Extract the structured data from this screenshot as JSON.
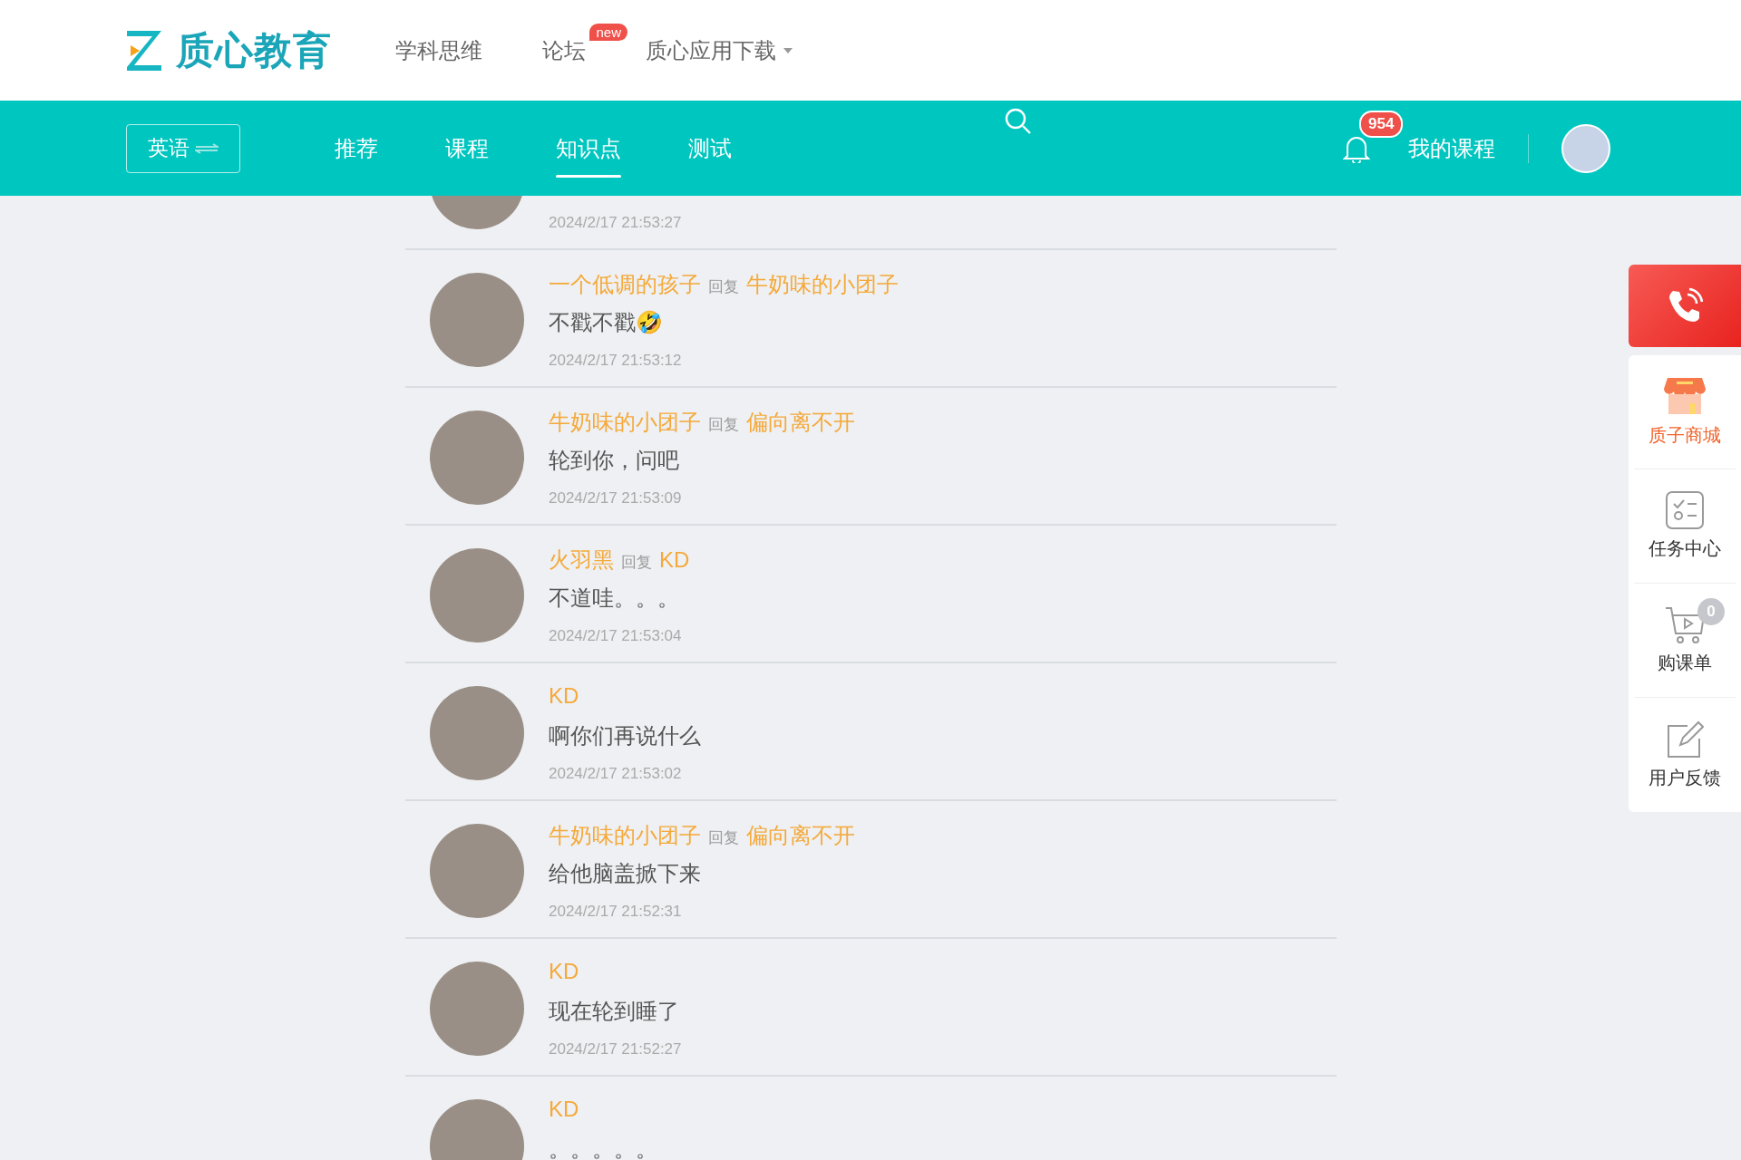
{
  "header": {
    "logo_text": "质心教育",
    "nav": [
      {
        "label": "学科思维"
      },
      {
        "label": "论坛",
        "badge": "new"
      },
      {
        "label": "质心应用下载",
        "dropdown": true
      }
    ]
  },
  "subnav": {
    "subject": "英语",
    "tabs": [
      {
        "label": "推荐",
        "selected": false
      },
      {
        "label": "课程",
        "selected": false
      },
      {
        "label": "知识点",
        "selected": true
      },
      {
        "label": "测试",
        "selected": false
      }
    ],
    "notification_count": "954",
    "my_courses": "我的课程"
  },
  "comments": [
    {
      "time": "2024/2/17 21:53:27"
    },
    {
      "author": "一个低调的孩子",
      "reply_label": "回复",
      "reply_to": "牛奶味的小团子",
      "text": "不戳不戳🤣",
      "time": "2024/2/17 21:53:12"
    },
    {
      "author": "牛奶味的小团子",
      "reply_label": "回复",
      "reply_to": "偏向离不开",
      "text": "轮到你，问吧",
      "time": "2024/2/17 21:53:09"
    },
    {
      "author": "火羽黑",
      "reply_label": "回复",
      "reply_to": "KD",
      "text": "不道哇。。。",
      "time": "2024/2/17 21:53:04"
    },
    {
      "author": "KD",
      "text": "啊你们再说什么",
      "time": "2024/2/17 21:53:02"
    },
    {
      "author": "牛奶味的小团子",
      "reply_label": "回复",
      "reply_to": "偏向离不开",
      "text": "给他脑盖掀下来",
      "time": "2024/2/17 21:52:31"
    },
    {
      "author": "KD",
      "text": "现在轮到睡了",
      "time": "2024/2/17 21:52:27"
    },
    {
      "author": "KD",
      "text": "。。。。。"
    }
  ],
  "sidebar": {
    "items": [
      {
        "kind": "phone"
      },
      {
        "kind": "shop",
        "label": "质子商城"
      },
      {
        "kind": "tasks",
        "label": "任务中心"
      },
      {
        "kind": "cart",
        "label": "购课单",
        "badge": "0"
      },
      {
        "kind": "feedback",
        "label": "用户反馈"
      }
    ]
  }
}
